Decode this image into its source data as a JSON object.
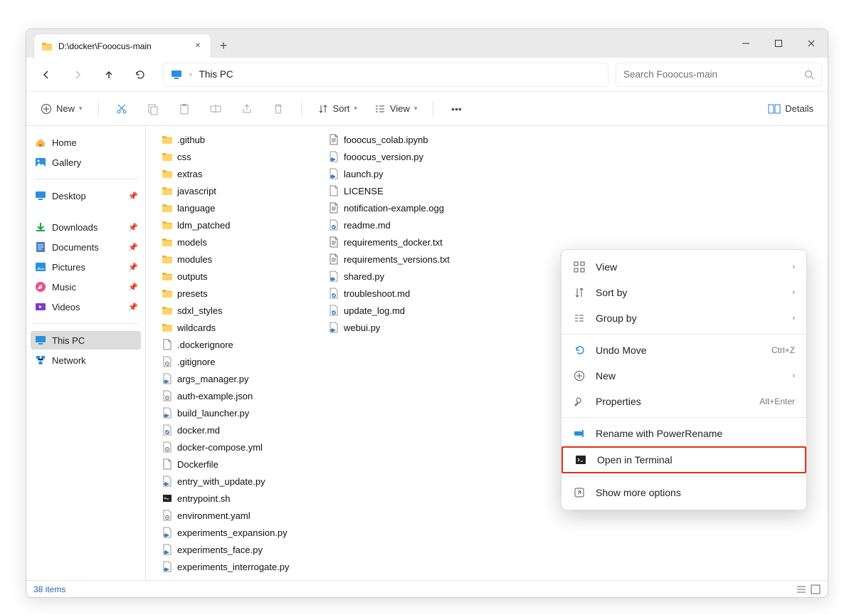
{
  "tab": {
    "title": "D:\\docker\\Fooocus-main"
  },
  "breadcrumb": {
    "root": "This PC"
  },
  "search": {
    "placeholder": "Search Fooocus-main"
  },
  "toolbar": {
    "new_label": "New",
    "sort_label": "Sort",
    "view_label": "View",
    "details_label": "Details"
  },
  "sidebar": {
    "home": "Home",
    "gallery": "Gallery",
    "desktop": "Desktop",
    "downloads": "Downloads",
    "documents": "Documents",
    "pictures": "Pictures",
    "music": "Music",
    "videos": "Videos",
    "thispc": "This PC",
    "network": "Network"
  },
  "files": {
    "col1": [
      {
        "name": ".github",
        "type": "folder"
      },
      {
        "name": "css",
        "type": "folder"
      },
      {
        "name": "extras",
        "type": "folder"
      },
      {
        "name": "javascript",
        "type": "folder"
      },
      {
        "name": "language",
        "type": "folder"
      },
      {
        "name": "ldm_patched",
        "type": "folder"
      },
      {
        "name": "models",
        "type": "folder"
      },
      {
        "name": "modules",
        "type": "folder"
      },
      {
        "name": "outputs",
        "type": "folder"
      },
      {
        "name": "presets",
        "type": "folder"
      },
      {
        "name": "sdxl_styles",
        "type": "folder"
      },
      {
        "name": "wildcards",
        "type": "folder"
      },
      {
        "name": ".dockerignore",
        "type": "file"
      },
      {
        "name": ".gitignore",
        "type": "gear"
      },
      {
        "name": "args_manager.py",
        "type": "py"
      },
      {
        "name": "auth-example.json",
        "type": "gear"
      },
      {
        "name": "build_launcher.py",
        "type": "py"
      },
      {
        "name": "docker.md",
        "type": "md"
      },
      {
        "name": "docker-compose.yml",
        "type": "gear"
      },
      {
        "name": "Dockerfile",
        "type": "file"
      },
      {
        "name": "entry_with_update.py",
        "type": "py"
      },
      {
        "name": "entrypoint.sh",
        "type": "sh"
      },
      {
        "name": "environment.yaml",
        "type": "gear"
      },
      {
        "name": "experiments_expansion.py",
        "type": "py"
      },
      {
        "name": "experiments_face.py",
        "type": "py"
      },
      {
        "name": "experiments_interrogate.py",
        "type": "py"
      }
    ],
    "col2": [
      {
        "name": "fooocus_colab.ipynb",
        "type": "txt"
      },
      {
        "name": "fooocus_version.py",
        "type": "py"
      },
      {
        "name": "launch.py",
        "type": "py"
      },
      {
        "name": "LICENSE",
        "type": "file"
      },
      {
        "name": "notification-example.ogg",
        "type": "txt"
      },
      {
        "name": "readme.md",
        "type": "md"
      },
      {
        "name": "requirements_docker.txt",
        "type": "txt"
      },
      {
        "name": "requirements_versions.txt",
        "type": "txt"
      },
      {
        "name": "shared.py",
        "type": "py"
      },
      {
        "name": "troubleshoot.md",
        "type": "md"
      },
      {
        "name": "update_log.md",
        "type": "md"
      },
      {
        "name": "webui.py",
        "type": "py"
      }
    ]
  },
  "status": {
    "count": "38 items"
  },
  "context_menu": {
    "view": "View",
    "sort": "Sort by",
    "group": "Group by",
    "undo": "Undo Move",
    "undo_sc": "Ctrl+Z",
    "new": "New",
    "properties": "Properties",
    "properties_sc": "Alt+Enter",
    "rename": "Rename with PowerRename",
    "terminal": "Open in Terminal",
    "more": "Show more options"
  }
}
